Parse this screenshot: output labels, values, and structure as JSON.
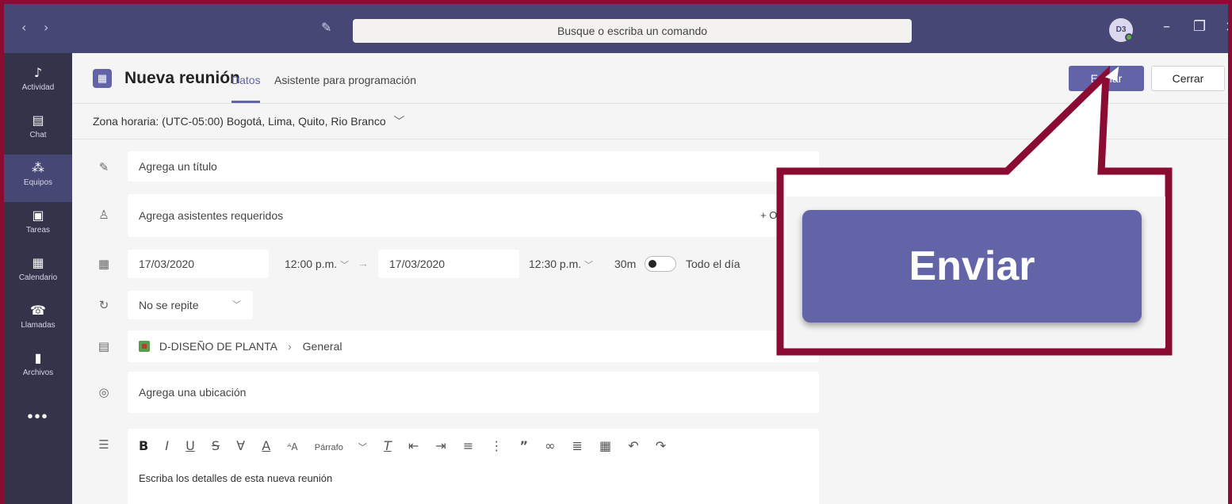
{
  "titlebar": {
    "search_placeholder": "Busque o escriba un comando",
    "avatar_initials": "D3"
  },
  "rail": {
    "items": [
      {
        "label": "Actividad",
        "icon": "bell-icon"
      },
      {
        "label": "Chat",
        "icon": "chat-icon"
      },
      {
        "label": "Equipos",
        "icon": "teams-icon"
      },
      {
        "label": "Tareas",
        "icon": "tasks-icon"
      },
      {
        "label": "Calendario",
        "icon": "calendar-icon"
      },
      {
        "label": "Llamadas",
        "icon": "phone-icon"
      },
      {
        "label": "Archivos",
        "icon": "file-icon"
      }
    ],
    "more": "•••"
  },
  "header": {
    "title": "Nueva reunión",
    "tabs": [
      {
        "label": "Datos"
      },
      {
        "label": "Asistente para programación"
      }
    ],
    "send_label": "Enviar",
    "close_label": "Cerrar"
  },
  "timezone": "Zona horaria: (UTC-05:00) Bogotá, Lima, Quito, Rio Branco",
  "form": {
    "title_placeholder": "Agrega un título",
    "attendees_placeholder": "Agrega asistentes requeridos",
    "optional_label": "+ Op",
    "start_date": "17/03/2020",
    "start_time": "12:00 p.m.",
    "end_date": "17/03/2020",
    "end_time": "12:30 p.m.",
    "duration": "30m",
    "all_day_label": "Todo el día",
    "repeat": "No se repite",
    "channel_team": "D-DISEÑO DE PLANTA",
    "channel_name": "General",
    "location_placeholder": "Agrega una ubicación",
    "paragraph_label": "Párrafo",
    "details_placeholder": "Escriba los detalles de esta nueva reunión"
  },
  "callout": {
    "zoom_label": "Enviar"
  },
  "colors": {
    "accent": "#6264a7",
    "titlebar": "#464775",
    "rail": "#33344a",
    "callout_border": "#8b0c33"
  }
}
